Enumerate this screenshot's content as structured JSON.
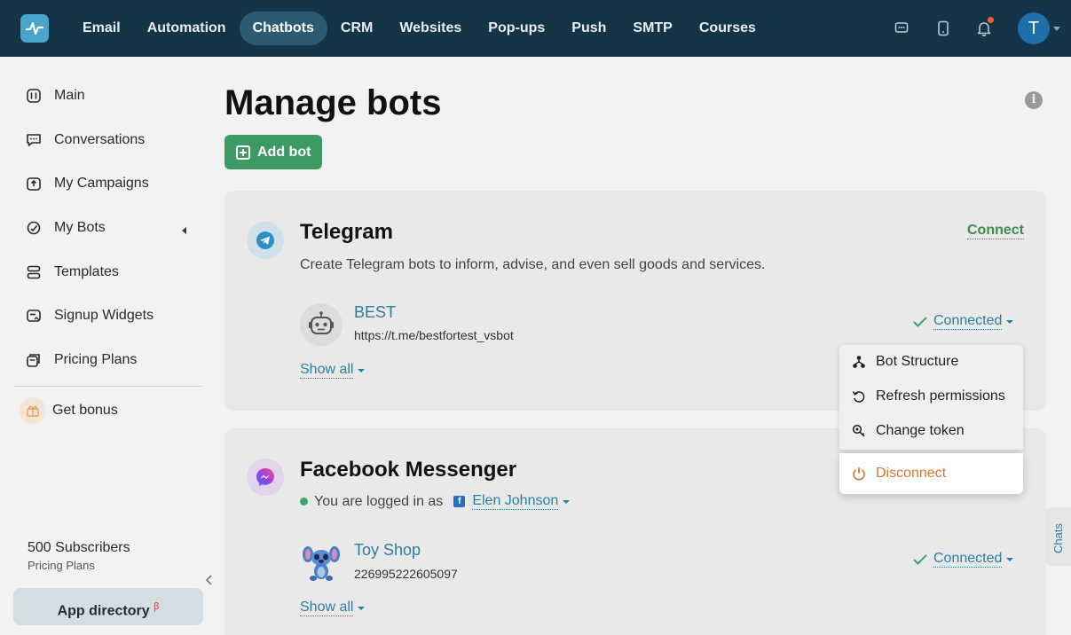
{
  "nav": {
    "items": [
      {
        "label": "Email"
      },
      {
        "label": "Automation"
      },
      {
        "label": "Chatbots",
        "active": true
      },
      {
        "label": "CRM"
      },
      {
        "label": "Websites"
      },
      {
        "label": "Pop-ups"
      },
      {
        "label": "Push"
      },
      {
        "label": "SMTP"
      },
      {
        "label": "Courses"
      }
    ],
    "avatar_initial": "T"
  },
  "sidebar": {
    "items": [
      {
        "label": "Main",
        "icon": "dashboard-icon"
      },
      {
        "label": "Conversations",
        "icon": "chat-icon"
      },
      {
        "label": "My Campaigns",
        "icon": "campaign-icon"
      },
      {
        "label": "My Bots",
        "icon": "bots-icon"
      },
      {
        "label": "Templates",
        "icon": "templates-icon"
      },
      {
        "label": "Signup Widgets",
        "icon": "widget-icon"
      },
      {
        "label": "Pricing Plans",
        "icon": "pricing-icon"
      }
    ],
    "bonus_label": "Get bonus",
    "subscribers": "500 Subscribers",
    "subscribers_sub": "Pricing Plans",
    "app_directory": "App directory",
    "app_directory_sup": "β"
  },
  "main": {
    "title": "Manage bots",
    "add_bot": "Add bot"
  },
  "telegram": {
    "title": "Telegram",
    "description": "Create Telegram bots to inform, advise, and even sell goods and services.",
    "connect": "Connect",
    "bot": {
      "name": "BEST",
      "url": "https://t.me/bestfortest_vsbot",
      "status": "Connected"
    },
    "show_all": "Show all"
  },
  "facebook": {
    "title": "Facebook Messenger",
    "logged_in_text": "You are logged in as",
    "user": "Elen Johnson",
    "bot": {
      "name": "Toy Shop",
      "id": "226995222605097",
      "status": "Connected"
    },
    "show_all": "Show all"
  },
  "dropdown": {
    "items": [
      {
        "label": "Bot Structure",
        "icon": "structure-icon"
      },
      {
        "label": "Refresh permissions",
        "icon": "refresh-icon"
      },
      {
        "label": "Change token",
        "icon": "key-icon"
      }
    ],
    "disconnect": "Disconnect"
  },
  "chats_tab": "Chats",
  "colors": {
    "topbar": "#143447",
    "accent_green": "#3e9a64",
    "link_blue": "#2d7ea0",
    "disconnect_orange": "#d9772a"
  }
}
